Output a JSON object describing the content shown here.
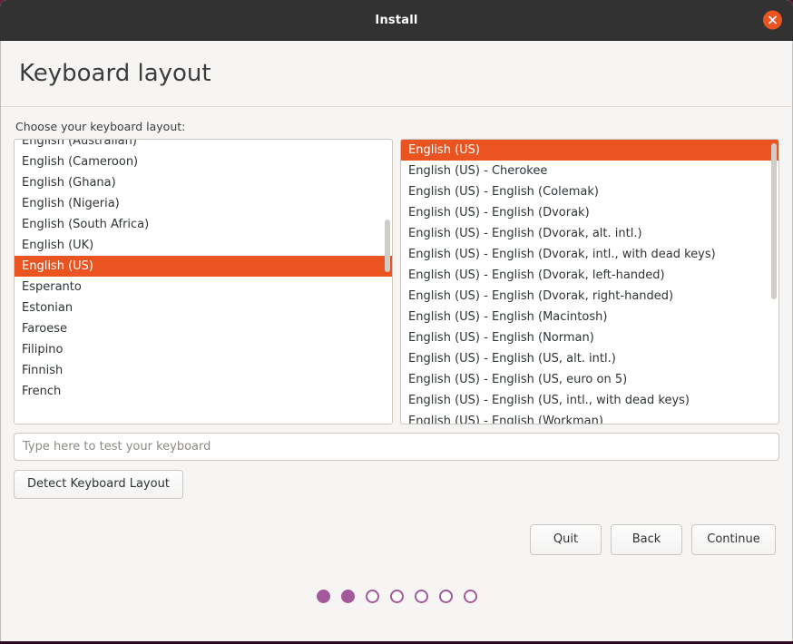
{
  "window": {
    "title": "Install",
    "close_icon": "close-x-icon"
  },
  "page": {
    "heading": "Keyboard layout",
    "prompt": "Choose your keyboard layout:"
  },
  "colors": {
    "accent_orange": "#e95420",
    "titlebar": "#333232",
    "dot_purple": "#a3589a",
    "background": "#f6f5f4",
    "desktop": "#5a1035"
  },
  "layout_list": {
    "label": "keyboard-layout-list",
    "selected": "English (US)",
    "items": [
      {
        "label": "English (Australian)",
        "selected": false
      },
      {
        "label": "English (Cameroon)",
        "selected": false
      },
      {
        "label": "English (Ghana)",
        "selected": false
      },
      {
        "label": "English (Nigeria)",
        "selected": false
      },
      {
        "label": "English (South Africa)",
        "selected": false
      },
      {
        "label": "English (UK)",
        "selected": false
      },
      {
        "label": "English (US)",
        "selected": true
      },
      {
        "label": "Esperanto",
        "selected": false
      },
      {
        "label": "Estonian",
        "selected": false
      },
      {
        "label": "Faroese",
        "selected": false
      },
      {
        "label": "Filipino",
        "selected": false
      },
      {
        "label": "Finnish",
        "selected": false
      },
      {
        "label": "French",
        "selected": false
      }
    ]
  },
  "variant_list": {
    "label": "keyboard-variant-list",
    "selected": "English (US)",
    "items": [
      {
        "label": "English (US)",
        "selected": true
      },
      {
        "label": "English (US) - Cherokee",
        "selected": false
      },
      {
        "label": "English (US) - English (Colemak)",
        "selected": false
      },
      {
        "label": "English (US) - English (Dvorak)",
        "selected": false
      },
      {
        "label": "English (US) - English (Dvorak, alt. intl.)",
        "selected": false
      },
      {
        "label": "English (US) - English (Dvorak, intl., with dead keys)",
        "selected": false
      },
      {
        "label": "English (US) - English (Dvorak, left-handed)",
        "selected": false
      },
      {
        "label": "English (US) - English (Dvorak, right-handed)",
        "selected": false
      },
      {
        "label": "English (US) - English (Macintosh)",
        "selected": false
      },
      {
        "label": "English (US) - English (Norman)",
        "selected": false
      },
      {
        "label": "English (US) - English (US, alt. intl.)",
        "selected": false
      },
      {
        "label": "English (US) - English (US, euro on 5)",
        "selected": false
      },
      {
        "label": "English (US) - English (US, intl., with dead keys)",
        "selected": false
      },
      {
        "label": "English (US) - English (Workman)",
        "selected": false
      }
    ]
  },
  "test_field": {
    "placeholder": "Type here to test your keyboard",
    "value": ""
  },
  "detect_button": {
    "label": "Detect Keyboard Layout"
  },
  "nav": {
    "quit": "Quit",
    "back": "Back",
    "continue": "Continue"
  },
  "progress": {
    "total": 7,
    "completed": 2,
    "dots": [
      true,
      true,
      false,
      false,
      false,
      false,
      false
    ]
  }
}
